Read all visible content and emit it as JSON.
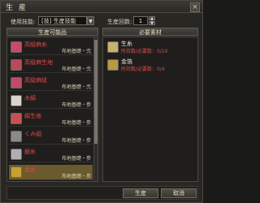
{
  "window": {
    "title": "生 産",
    "close": "×"
  },
  "controls": {
    "skill_label": "使用技能:",
    "skill_value": "[技] 生産技能",
    "count_label": "生産回数:",
    "count_value": "1",
    "up": "▲",
    "down": "▼",
    "dd": "▼"
  },
  "list": {
    "header": "生産可能品",
    "items": [
      {
        "name": "高級麻糸",
        "req": "布地基礎・弐",
        "color": "#e04848",
        "icon_color": "#c84a6a"
      },
      {
        "name": "高級麻生地",
        "req": "布地基礎・弐",
        "color": "#e04848",
        "icon_color": "#b84a5a"
      },
      {
        "name": "高級麻紐",
        "req": "布地基礎・弐",
        "color": "#e04848",
        "icon_color": "#c04a68"
      },
      {
        "name": "木綿",
        "req": "布地基礎・参",
        "color": "#e04848",
        "icon_color": "#d8d4cc"
      },
      {
        "name": "綿生地",
        "req": "布地基礎・参",
        "color": "#e04848",
        "icon_color": "#c85050"
      },
      {
        "name": "くみ組",
        "req": "布地基礎・参",
        "color": "#e04848",
        "icon_color": "#8a8a8a"
      },
      {
        "name": "銀糸",
        "req": "布地基礎・参",
        "color": "#e04848",
        "icon_color": "#b0b0b4"
      },
      {
        "name": "金糸",
        "req": "布地基礎・参",
        "color": "#e04848",
        "icon_color": "#c8a030"
      }
    ]
  },
  "materials": {
    "header": "必要素材",
    "items": [
      {
        "name": "生糸",
        "qty": "所持数/必要数：0/10",
        "color": "#ece6d4",
        "qty_color": "#e04848",
        "icon_color": "#c8b070"
      },
      {
        "name": "金箔",
        "qty": "所持数/必要数：0/4",
        "color": "#ece6d4",
        "qty_color": "#e04848",
        "icon_color": "#b89840"
      }
    ]
  },
  "buttons": {
    "produce": "生産",
    "cancel": "取消"
  }
}
